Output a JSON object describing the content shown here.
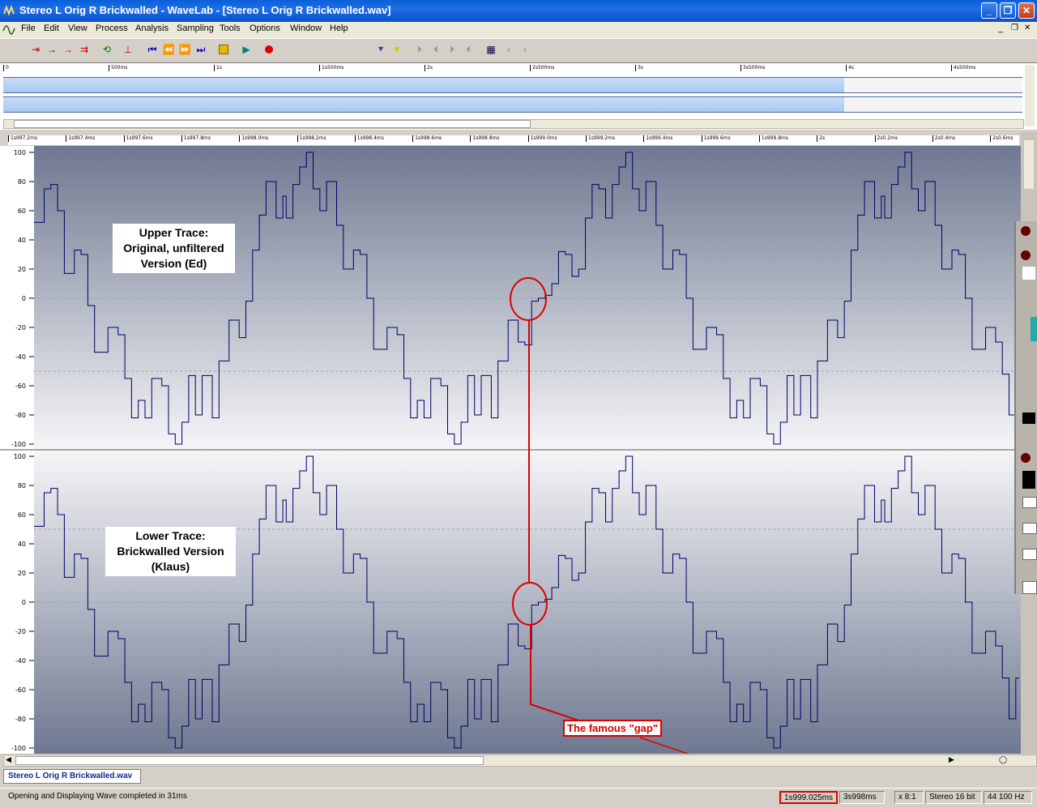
{
  "window": {
    "title": "Stereo L Orig R Brickwalled - WaveLab - [Stereo L Orig R Brickwalled.wav]",
    "minimize": "_",
    "maximize": "❐",
    "close": "✕"
  },
  "menu": [
    "File",
    "Edit",
    "View",
    "Process",
    "Analysis",
    "Sampling",
    "Tools",
    "Options",
    "Window",
    "Help"
  ],
  "overview_ruler": [
    "0",
    "500ms",
    "1s",
    "1s500ms",
    "2s",
    "2s500ms",
    "3s",
    "3s500ms",
    "4s",
    "4s500ms"
  ],
  "main_ruler": [
    "1s997.2ms",
    "1s997.4ms",
    "1s997.6ms",
    "1s997.8ms",
    "1s998.0ms",
    "1s998.2ms",
    "1s998.4ms",
    "1s998.6ms",
    "1s998.8ms",
    "1s999.0ms",
    "1s999.2ms",
    "1s999.4ms",
    "1s999.6ms",
    "1s999.8ms",
    "2s",
    "2s0.2ms",
    "2s0.4ms",
    "2s0.6ms"
  ],
  "y_labels": [
    "100",
    "80",
    "60",
    "40",
    "20",
    "0",
    "-20",
    "-40",
    "-60",
    "-80",
    "-100"
  ],
  "upper_label": "Upper Trace:\nOriginal, unfiltered\nVersion (Ed)",
  "lower_label": "Lower Trace:\nBrickwalled Version\n(Klaus)",
  "gap_label": "The famous \"gap\"",
  "tab_label": "Stereo L Orig R Brickwalled.wav",
  "status": {
    "message": "Opening and Displaying Wave completed in 31ms",
    "cursor": "1s999.025ms",
    "length": "3s998ms",
    "zoom": "x 8:1",
    "format": "Stereo 16 bit",
    "rate": "44 100 Hz"
  },
  "colors": {
    "wave": "#000066",
    "annotation": "#dd0000",
    "titlebar": "#0a5fd8"
  },
  "wave_samples": [
    52,
    52,
    52,
    75,
    75,
    78,
    78,
    60,
    60,
    17,
    17,
    17,
    33,
    33,
    30,
    30,
    -5,
    -5,
    -37,
    -37,
    -37,
    -37,
    -20,
    -20,
    -20,
    -25,
    -25,
    -55,
    -55,
    -82,
    -82,
    -70,
    -70,
    -82,
    -82,
    -55,
    -55,
    -55,
    -60,
    -60,
    -93,
    -93,
    -100,
    -100,
    -85,
    -85,
    -53,
    -53,
    -80,
    -80,
    -53,
    -53,
    -53,
    -82,
    -82,
    -43,
    -43,
    -43,
    -15,
    -15,
    -15,
    -27,
    -27,
    -2,
    -2,
    33,
    33,
    57,
    57,
    80,
    80,
    80,
    55,
    55,
    70,
    55,
    55,
    78,
    78,
    90,
    90,
    100,
    100,
    75,
    75,
    60,
    60,
    80,
    80,
    80,
    50,
    50,
    20,
    20,
    20,
    33,
    33,
    30,
    30,
    0,
    0,
    -35,
    -35,
    -35,
    -35,
    -20,
    -20,
    -20,
    -25,
    -25,
    -55,
    -55,
    -82,
    -82,
    -70,
    -70,
    -82,
    -82,
    -55,
    -55,
    -55,
    -60,
    -60,
    -93,
    -93,
    -100,
    -100,
    -85,
    -85,
    -53,
    -53,
    -80,
    -80,
    -53,
    -53,
    -53,
    -82,
    -82,
    -43,
    -43,
    -43,
    -15,
    -15,
    -15,
    -30,
    -30,
    -32,
    -32,
    -2,
    -2,
    0,
    0,
    2,
    2,
    10,
    10,
    32,
    32,
    30,
    30,
    15,
    15,
    20,
    20,
    55,
    55,
    78,
    78,
    75,
    75,
    55,
    55,
    78,
    78,
    90,
    90,
    100,
    100,
    75,
    75,
    60,
    60,
    80,
    80,
    80,
    50,
    50,
    20,
    20,
    20,
    33,
    33,
    30,
    30,
    0,
    0,
    -35,
    -35,
    -35,
    -35,
    -20,
    -20,
    -20,
    -25,
    -25,
    -55,
    -55,
    -82,
    -82,
    -70,
    -70,
    -82,
    -82,
    -55,
    -55,
    -55,
    -60,
    -60,
    -93,
    -93,
    -100,
    -100,
    -85,
    -85,
    -53,
    -53,
    -80,
    -80,
    -53,
    -53,
    -53,
    -82,
    -82,
    -43,
    -43,
    -43,
    -15,
    -15,
    -15,
    -27,
    -27,
    -2,
    -2,
    33,
    33,
    57,
    57,
    80,
    80,
    80,
    55,
    55,
    70,
    55,
    55,
    78,
    78,
    90,
    90,
    100,
    100,
    75,
    75,
    60,
    60,
    80,
    80,
    80,
    50,
    50,
    20,
    20,
    20,
    33,
    33,
    30,
    30,
    0,
    0,
    -35,
    -35,
    -35,
    -35,
    -20,
    -20,
    -20,
    -30,
    -30,
    -52,
    -52,
    -80,
    -80,
    -52
  ]
}
